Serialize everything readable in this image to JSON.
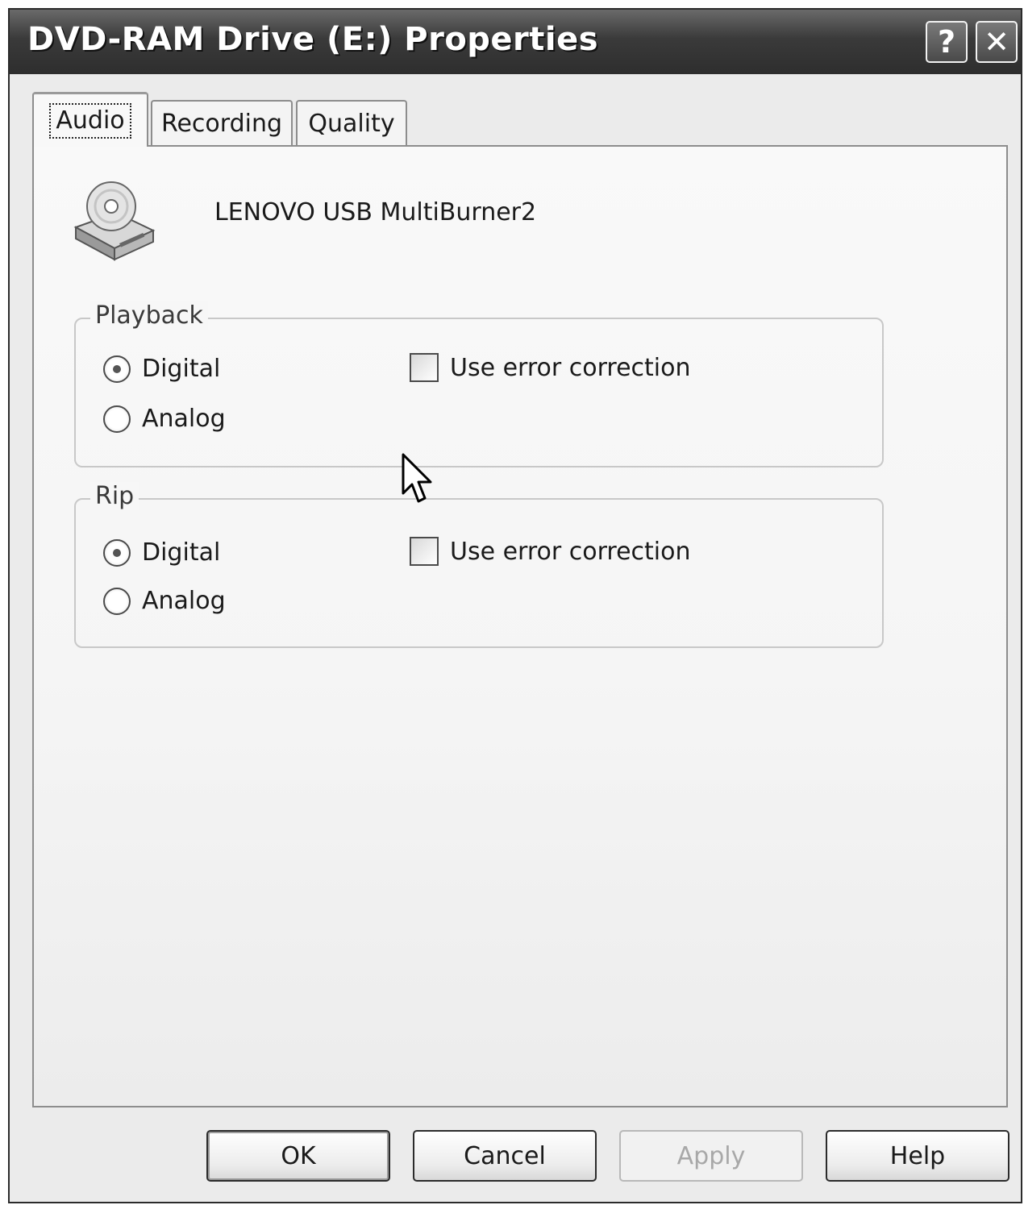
{
  "window": {
    "title": "DVD-RAM Drive (E:) Properties",
    "help_glyph": "?",
    "close_glyph": "✕"
  },
  "tabs": [
    {
      "label": "Audio",
      "active": true
    },
    {
      "label": "Recording",
      "active": false
    },
    {
      "label": "Quality",
      "active": false
    }
  ],
  "device": {
    "name": "LENOVO  USB MultiBurner2",
    "icon": "cd-drive-icon"
  },
  "playback": {
    "group_label": "Playback",
    "digital_label": "Digital",
    "analog_label": "Analog",
    "selected": "Digital",
    "error_correction_label": "Use error correction",
    "error_correction_checked": false
  },
  "rip": {
    "group_label": "Rip",
    "digital_label": "Digital",
    "analog_label": "Analog",
    "selected": "Digital",
    "error_correction_label": "Use error correction",
    "error_correction_checked": false
  },
  "buttons": {
    "ok": "OK",
    "cancel": "Cancel",
    "apply": "Apply",
    "help": "Help"
  }
}
